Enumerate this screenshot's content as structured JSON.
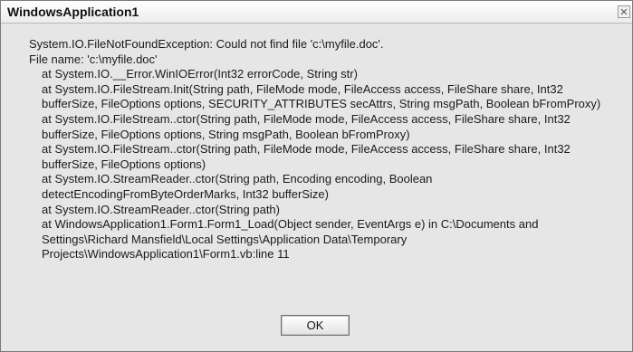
{
  "window": {
    "title": "WindowsApplication1",
    "close_glyph": "✕"
  },
  "message": {
    "lines": [
      {
        "text": "System.IO.FileNotFoundException: Could not find file 'c:\\myfile.doc'.",
        "indent": false
      },
      {
        "text": "File name: 'c:\\myfile.doc'",
        "indent": false
      },
      {
        "text": "at System.IO.__Error.WinIOError(Int32 errorCode, String str)",
        "indent": true
      },
      {
        "text": "at System.IO.FileStream.Init(String path, FileMode mode, FileAccess access, FileShare share, Int32 bufferSize, FileOptions options, SECURITY_ATTRIBUTES secAttrs, String msgPath, Boolean bFromProxy)",
        "indent": true
      },
      {
        "text": "at System.IO.FileStream..ctor(String path, FileMode mode, FileAccess access, FileShare share, Int32 bufferSize, FileOptions options, String msgPath, Boolean bFromProxy)",
        "indent": true
      },
      {
        "text": "at System.IO.FileStream..ctor(String path, FileMode mode, FileAccess access, FileShare share, Int32 bufferSize, FileOptions options)",
        "indent": true
      },
      {
        "text": "at System.IO.StreamReader..ctor(String path, Encoding encoding, Boolean detectEncodingFromByteOrderMarks, Int32 bufferSize)",
        "indent": true
      },
      {
        "text": "at System.IO.StreamReader..ctor(String path)",
        "indent": true
      },
      {
        "text": "at WindowsApplication1.Form1.Form1_Load(Object sender, EventArgs e) in C:\\Documents and Settings\\Richard Mansfield\\Local Settings\\Application Data\\Temporary Projects\\WindowsApplication1\\Form1.vb:line 11",
        "indent": true
      }
    ]
  },
  "buttons": {
    "ok_label": "OK"
  }
}
